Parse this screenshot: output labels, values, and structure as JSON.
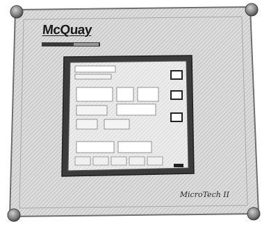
{
  "panel": {
    "brand": "McQuay",
    "model": "MicroTech II"
  },
  "colors": {
    "panel_face": "#d9d9d9",
    "panel_edge": "#8f8f8f",
    "screen_bezel": "#333333",
    "screen_face": "#e6e6e6",
    "screw": "#7d7d7d"
  },
  "icons": [
    "screw-icon"
  ]
}
